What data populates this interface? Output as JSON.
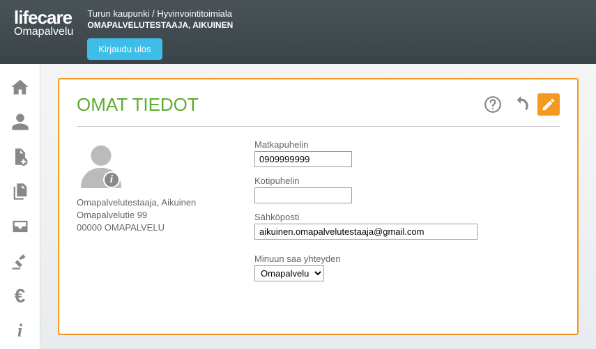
{
  "header": {
    "logo_main": "lifecare",
    "logo_sub": "Omapalvelu",
    "org": "Turun kaupunki / Hyvinvointitoimiala",
    "user": "OMAPALVELUTESTAAJA, AIKUINEN",
    "logout_label": "Kirjaudu ulos"
  },
  "panel": {
    "title": "OMAT TIEDOT"
  },
  "user": {
    "name": "Omapalvelutestaaja, Aikuinen",
    "address": "Omapalvelutie 99",
    "city": "00000 OMAPALVELU"
  },
  "form": {
    "mobile_label": "Matkapuhelin",
    "mobile_value": "0909999999",
    "home_phone_label": "Kotipuhelin",
    "home_phone_value": "",
    "email_label": "Sähköposti",
    "email_value": "aikuinen.omapalvelutestaaja@gmail.com",
    "contact_label": "Minuun saa yhteyden",
    "contact_value": "Omapalvelu"
  }
}
